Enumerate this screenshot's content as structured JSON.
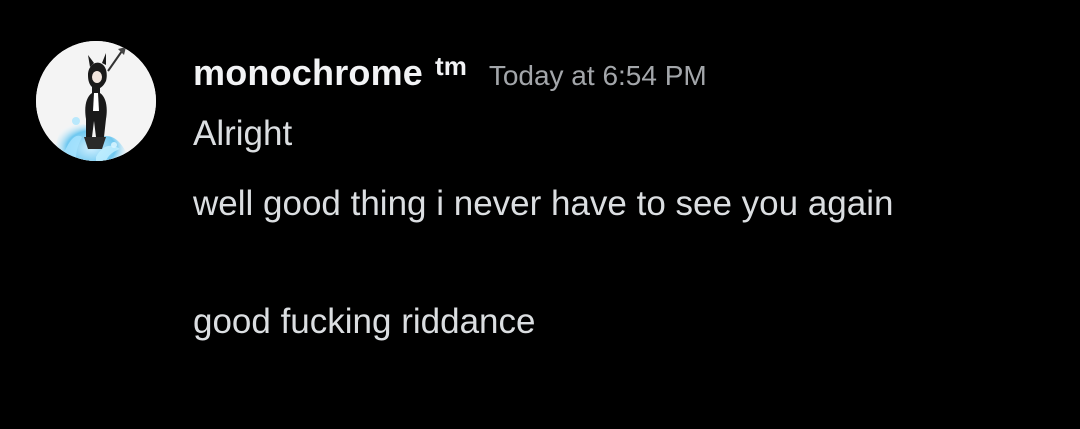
{
  "message": {
    "author": {
      "username": "monochrome",
      "tag": "tm",
      "avatar_icon": "anime-character-avatar"
    },
    "timestamp": "Today at 6:54 PM",
    "lines": [
      "Alright",
      "well good thing i never have to see you again",
      "good fucking riddance"
    ]
  },
  "colors": {
    "background": "#000000",
    "username": "#f2f3f5",
    "timestamp": "#a3a6aa",
    "message_text": "#dbdee1",
    "avatar_glow": "#7fd8ff"
  }
}
